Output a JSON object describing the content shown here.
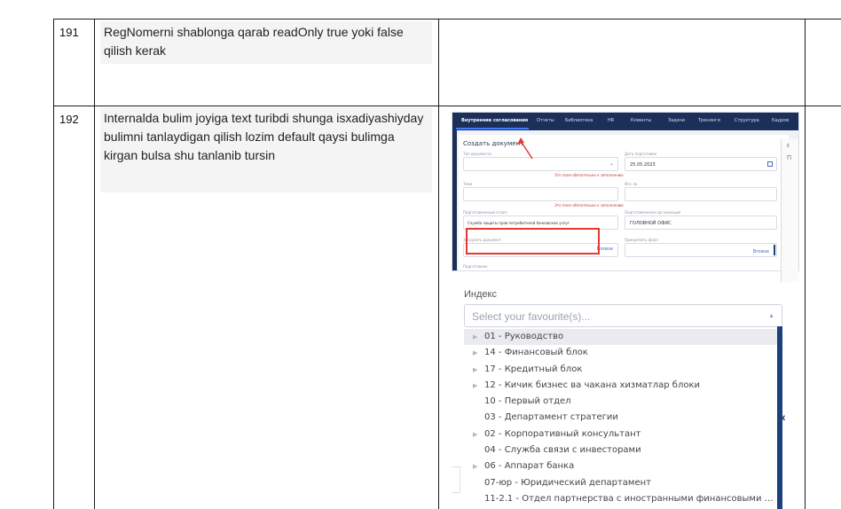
{
  "rows": [
    {
      "num": "191",
      "text": "RegNomerni shablonga qarab readOnly true yoki false qilish kerak"
    },
    {
      "num": "192",
      "text": "Internalda bulim joyiga text turibdi shunga isxadiyashiyday bulimni tanlaydigan qilish lozim default qaysi bulimga kirgan bulsa shu tanlanib tursin"
    }
  ],
  "app_screenshot": {
    "nav": [
      "Внутренние согласования",
      "Отчеты",
      "Библиотека",
      "HR",
      "Клиенты",
      "Задачи",
      "Тренинги",
      "Структура",
      "Кадров"
    ],
    "form_title": "Создать документ",
    "fields": {
      "doc_type_label": "Тип документа",
      "doc_type_error": "Это поле обязательно к заполнению",
      "date_label": "Дата подготовки",
      "date_value": "25.05.2023",
      "topic_label": "Тема",
      "topic_error": "Это поле обязательно к заполнению",
      "ref_label": "Исх. №",
      "dept_label": "Подготовленный отдел",
      "dept_value": "Служба защиты прав потребителей банковских услуг",
      "org_label": "Подготовленная организация",
      "org_value": "ГОЛОВНОЙ ОФИС",
      "upload_label": "Загрузить документ",
      "browse_1": "Browse",
      "attach_label": "Прикрепить файл",
      "browse_2": "Browse",
      "prepared_label": "Подготовлен"
    }
  },
  "dropdown_screenshot": {
    "label": "Индекс",
    "placeholder": "Select your favourite(s)...",
    "options": [
      {
        "text": "01 - Руководство",
        "expandable": true,
        "highlighted": true
      },
      {
        "text": "14 - Финансовый блок",
        "expandable": true,
        "highlighted": false
      },
      {
        "text": "17 - Кредитный блок",
        "expandable": true,
        "highlighted": false
      },
      {
        "text": "12 - Кичик бизнес ва чакана хизматлар блоки",
        "expandable": true,
        "highlighted": false
      },
      {
        "text": "10 - Первый отдел",
        "expandable": false,
        "highlighted": false
      },
      {
        "text": "03 - Департамент стратегии",
        "expandable": false,
        "highlighted": false
      },
      {
        "text": "02 - Корпоративный консультант",
        "expandable": true,
        "highlighted": false
      },
      {
        "text": "04 - Служба связи с инвесторами",
        "expandable": false,
        "highlighted": false
      },
      {
        "text": "06 - Аппарат банка",
        "expandable": true,
        "highlighted": false
      },
      {
        "text": "07-юр - Юридический департамент",
        "expandable": false,
        "highlighted": false
      },
      {
        "text": "11-2.1 - Отдел партнерства с иностранными финансовыми институ...",
        "expandable": false,
        "highlighted": false
      }
    ]
  },
  "colors": {
    "navbar": "#1b2f59",
    "highlight_box": "#e53935",
    "scrollbar": "#1d3f7a"
  }
}
